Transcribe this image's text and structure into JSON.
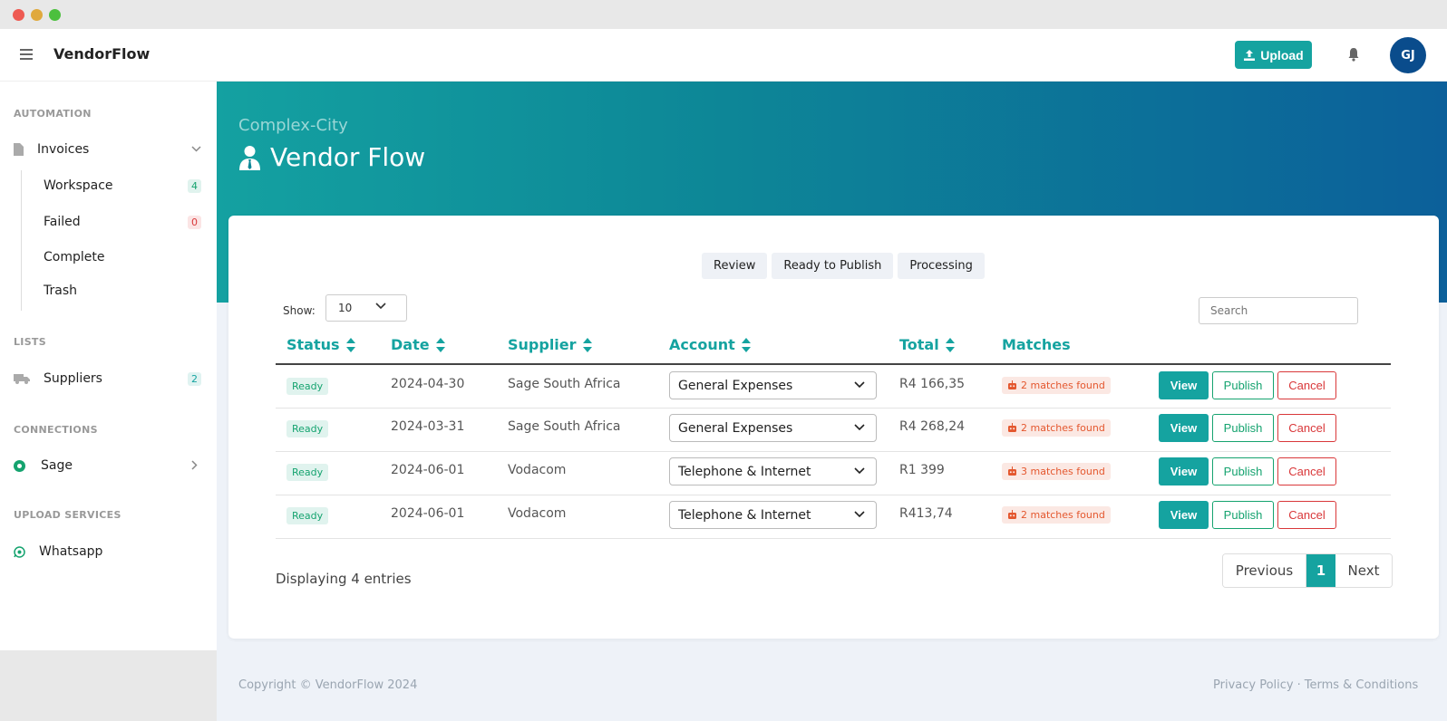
{
  "app": {
    "brand": "VendorFlow",
    "upload_label": "Upload",
    "avatar_initials": "GJ"
  },
  "sidebar": {
    "automation_header": "AUTOMATION",
    "invoices_label": "Invoices",
    "sub_items": [
      {
        "label": "Workspace",
        "count": "4"
      },
      {
        "label": "Failed",
        "count": "0"
      },
      {
        "label": "Complete"
      },
      {
        "label": "Trash"
      }
    ],
    "lists_header": "LISTS",
    "suppliers_label": "Suppliers",
    "suppliers_count": "2",
    "connections_header": "CONNECTIONS",
    "sage_label": "Sage",
    "upload_services_header": "UPLOAD SERVICES",
    "whatsapp_label": "Whatsapp"
  },
  "hero": {
    "subtitle": "Complex-City",
    "title": "Vendor Flow"
  },
  "tabs": [
    "Review",
    "Ready to Publish",
    "Processing"
  ],
  "controls": {
    "show_label": "Show:",
    "show_value": "10",
    "search_placeholder": "Search"
  },
  "table": {
    "headers": [
      "Status",
      "Date",
      "Supplier",
      "Account",
      "Total",
      "Matches"
    ],
    "rows": [
      {
        "status": "Ready",
        "date": "2024-04-30",
        "supplier": "Sage South Africa",
        "account": "General Expenses",
        "total": "R4 166,35",
        "matches": "2 matches found"
      },
      {
        "status": "Ready",
        "date": "2024-03-31",
        "supplier": "Sage South Africa",
        "account": "General Expenses",
        "total": "R4 268,24",
        "matches": "2 matches found"
      },
      {
        "status": "Ready",
        "date": "2024-06-01",
        "supplier": "Vodacom",
        "account": "Telephone & Internet",
        "total": "R1 399",
        "matches": "3 matches found"
      },
      {
        "status": "Ready",
        "date": "2024-06-01",
        "supplier": "Vodacom",
        "account": "Telephone & Internet",
        "total": "R413,74",
        "matches": "2 matches found"
      }
    ],
    "view_label": "View",
    "publish_label": "Publish",
    "cancel_label": "Cancel"
  },
  "pagination": {
    "displaying": "Displaying 4 entries",
    "previous": "Previous",
    "current": "1",
    "next": "Next"
  },
  "footer": {
    "copyright": "Copyright © VendorFlow 2024",
    "privacy": "Privacy Policy",
    "separator": "·",
    "terms": "Terms & Conditions"
  },
  "colors": {
    "accent": "#15a3a0",
    "danger": "#d9383a",
    "success": "#15a36f",
    "avatar": "#0a4c8c"
  }
}
